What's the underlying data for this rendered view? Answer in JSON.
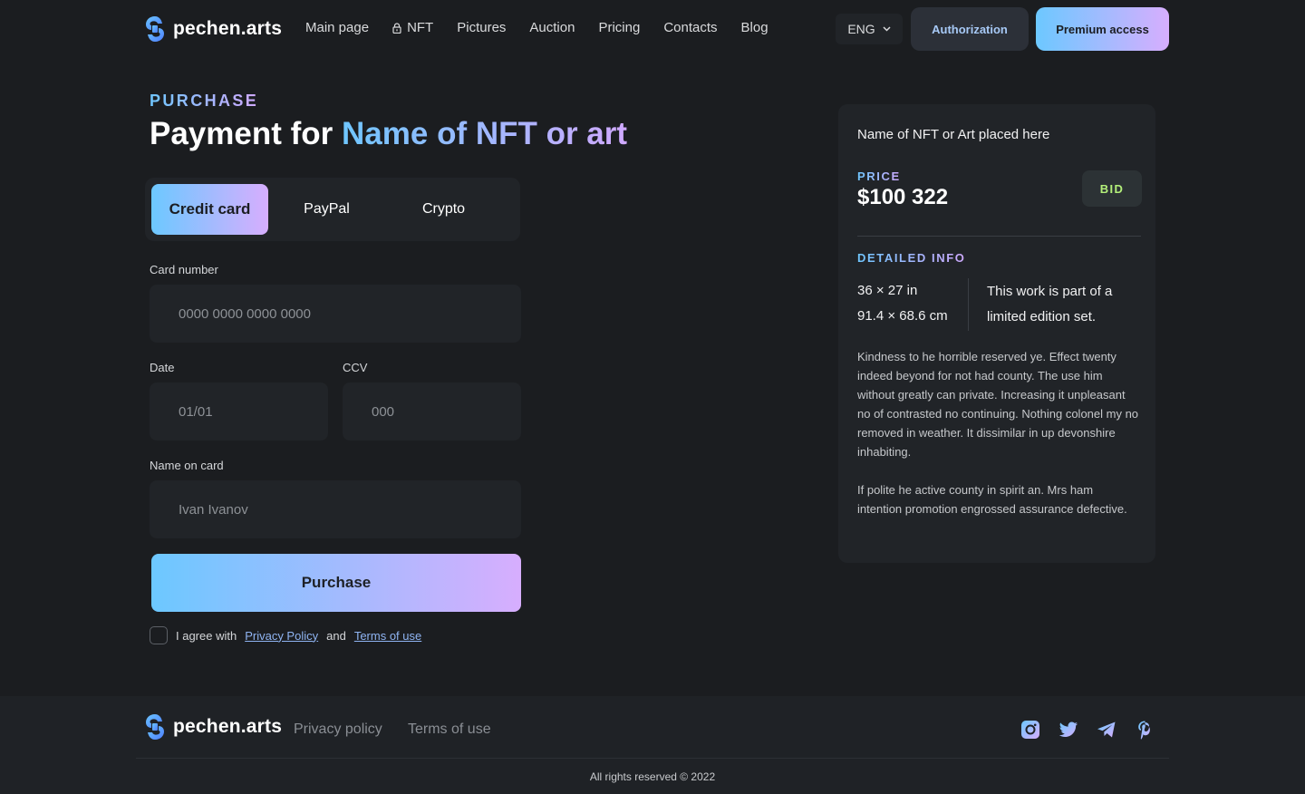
{
  "brand": {
    "name": "pechen.arts"
  },
  "nav": {
    "items": [
      {
        "label": "Main page"
      },
      {
        "label": "NFT",
        "icon": "lock-icon"
      },
      {
        "label": "Pictures"
      },
      {
        "label": "Auction"
      },
      {
        "label": "Pricing"
      },
      {
        "label": "Contacts"
      },
      {
        "label": "Blog"
      }
    ]
  },
  "header": {
    "language": "ENG",
    "auth_label": "Authorization",
    "premium_label": "Premium access"
  },
  "title": {
    "eyebrow": "PURCHASE",
    "prefix": "Payment for",
    "highlight": "Name of NFT or art"
  },
  "tabs": [
    {
      "label": "Credit card",
      "active": true
    },
    {
      "label": "PayPal",
      "active": false
    },
    {
      "label": "Crypto",
      "active": false
    }
  ],
  "form": {
    "card_number": {
      "label": "Card number",
      "placeholder": "0000 0000 0000 0000"
    },
    "date": {
      "label": "Date",
      "placeholder": "01/01"
    },
    "ccv": {
      "label": "CCV",
      "placeholder": "000"
    },
    "name": {
      "label": "Name on card",
      "placeholder": "Ivan Ivanov"
    },
    "purchase_label": "Purchase",
    "agree": {
      "text": "I agree with",
      "privacy": "Privacy Policy",
      "and": "and",
      "terms": "Terms of use"
    }
  },
  "card": {
    "name": "Name of NFT or Art placed here",
    "price_label": "PRICE",
    "price": "$100 322",
    "bid_label": "BID",
    "detail_label": "DETAILED INFO",
    "size_in": "36 × 27 in",
    "size_cm": "91.4 × 68.6 cm",
    "edition": "This work is part of a limited edition set.",
    "desc1": "Kindness to he horrible reserved ye. Effect twenty indeed beyond for not had county. The use him without greatly can private. Increasing it unpleasant no of contrasted no continuing. Nothing colonel my no removed in weather. It dissimilar in up devonshire inhabiting.",
    "desc2": "If polite he active county in spirit an. Mrs ham intention promotion engrossed assurance defective."
  },
  "footer": {
    "privacy": "Privacy policy",
    "terms": "Terms of use",
    "copyright": "All rights reserved © 2022",
    "social": [
      "instagram-icon",
      "twitter-icon",
      "telegram-icon",
      "pinterest-icon"
    ]
  },
  "colors": {
    "background": "#1b1d20",
    "panel": "#212428",
    "gradient_start": "#6cc8ff",
    "gradient_end": "#d7aefe",
    "bid_text": "#b3ef7a"
  }
}
